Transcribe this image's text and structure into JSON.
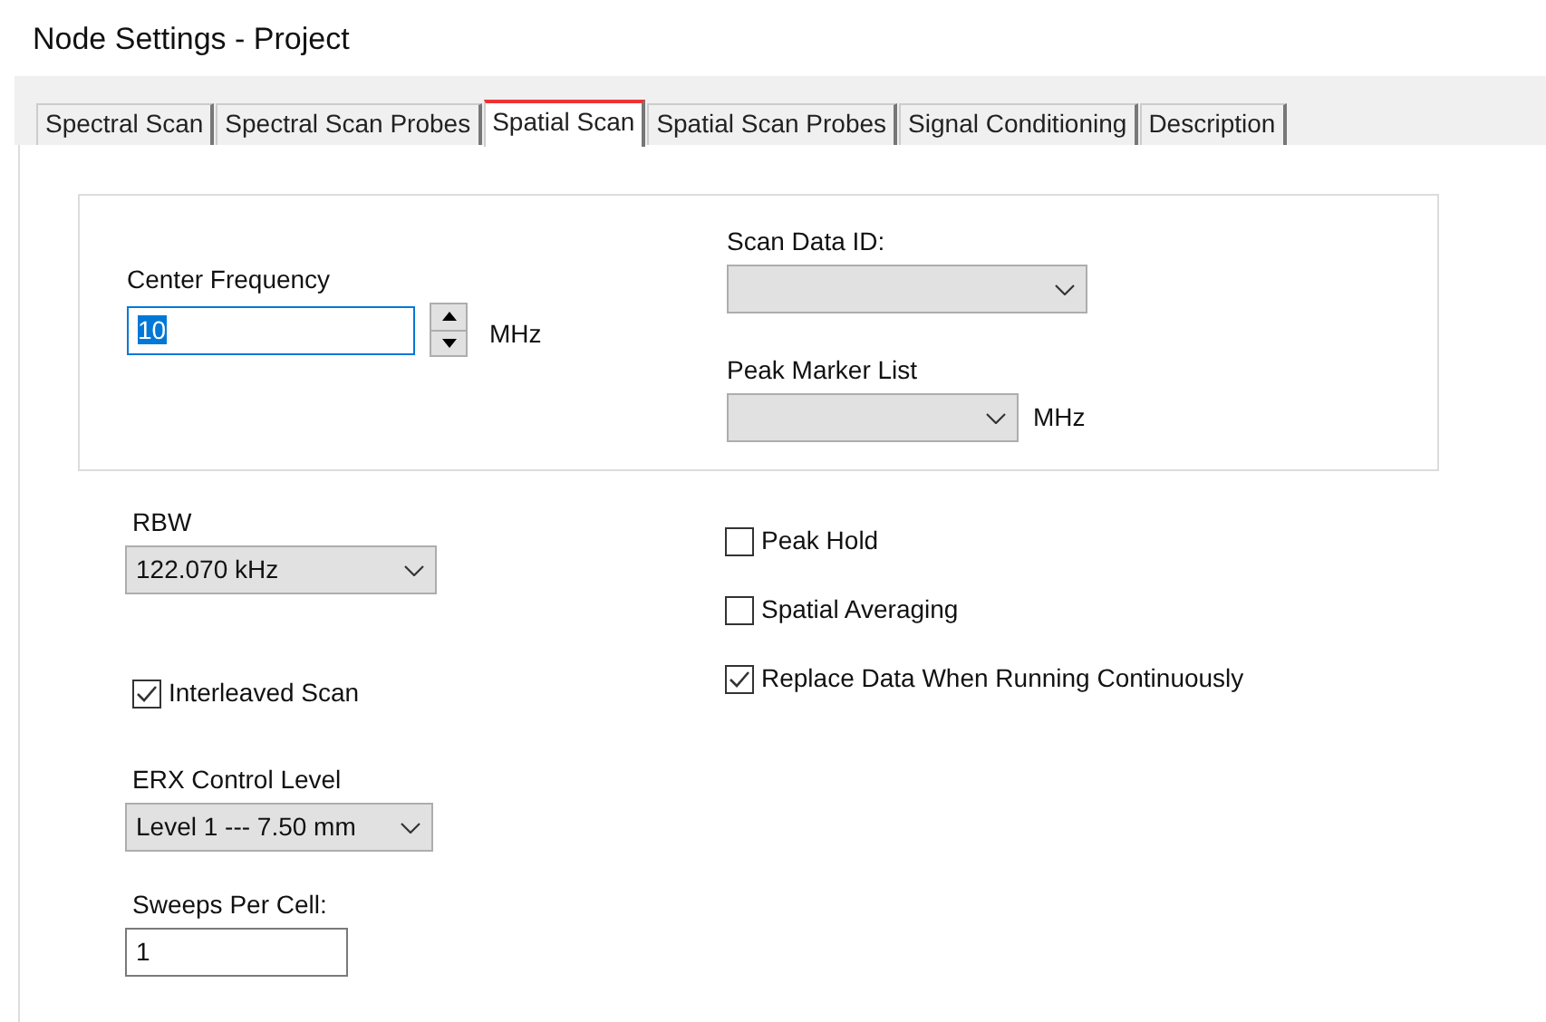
{
  "window": {
    "title": "Node Settings - Project"
  },
  "tabs": [
    {
      "label": "Spectral Scan",
      "selected": false
    },
    {
      "label": "Spectral Scan Probes",
      "selected": false
    },
    {
      "label": "Spatial Scan",
      "selected": true
    },
    {
      "label": "Spatial Scan Probes",
      "selected": false
    },
    {
      "label": "Signal Conditioning",
      "selected": false
    },
    {
      "label": "Description",
      "selected": false
    }
  ],
  "group": {
    "center_frequency": {
      "label": "Center Frequency",
      "value": "10",
      "value_selected": true,
      "unit": "MHz"
    },
    "scan_data_id": {
      "label": "Scan Data ID:"
    },
    "peak_marker_list": {
      "label": "Peak Marker List",
      "unit": "MHz"
    }
  },
  "rbw": {
    "label": "RBW",
    "value": "122.070 kHz"
  },
  "interleaved_scan": {
    "label": "Interleaved Scan",
    "checked": true
  },
  "erx_control_level": {
    "label": "ERX Control Level",
    "value": "Level 1 --- 7.50 mm"
  },
  "sweeps_per_cell": {
    "label": "Sweeps Per Cell:",
    "value": "1"
  },
  "options": [
    {
      "label": "Peak Hold",
      "checked": false
    },
    {
      "label": "Spatial Averaging",
      "checked": false
    },
    {
      "label": "Replace Data When Running Continuously",
      "checked": true
    }
  ]
}
